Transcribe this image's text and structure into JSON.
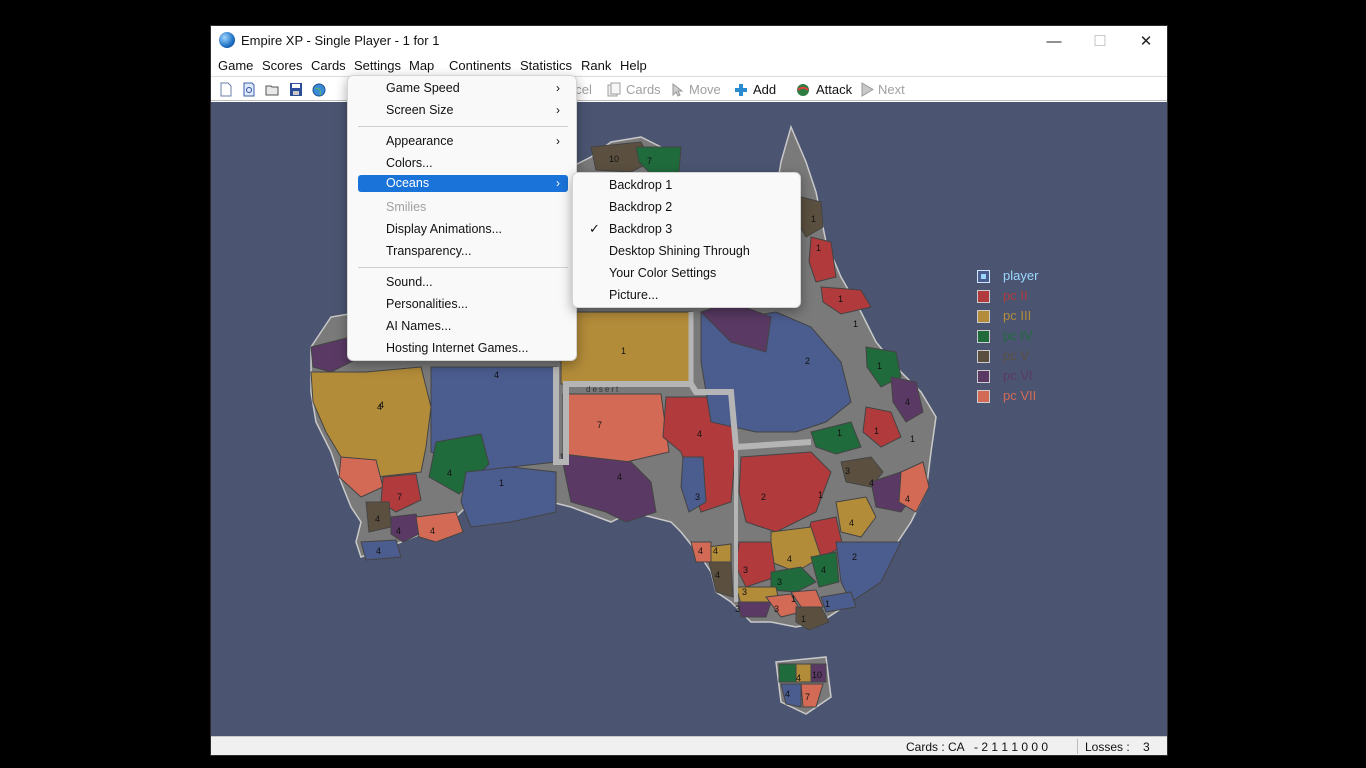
{
  "window": {
    "title": "Empire XP - Single Player - 1 for 1"
  },
  "menubar": [
    "Game",
    "Scores",
    "Cards",
    "Settings",
    "Map",
    "Continents",
    "Statistics",
    "Rank",
    "Help"
  ],
  "toolbar": {
    "cancel_label": "ncel",
    "cards_label": "Cards",
    "move_label": "Move",
    "add_label": "Add",
    "attack_label": "Attack",
    "next_label": "Next"
  },
  "settings_menu": {
    "game_speed": "Game Speed",
    "screen_size": "Screen Size",
    "appearance": "Appearance",
    "colors": "Colors...",
    "oceans": "Oceans",
    "smilies": "Smilies",
    "display_animations": "Display Animations...",
    "transparency": "Transparency...",
    "sound": "Sound...",
    "personalities": "Personalities...",
    "ai_names": "AI Names...",
    "hosting": "Hosting Internet Games..."
  },
  "oceans_menu": {
    "backdrop1": "Backdrop 1",
    "backdrop2": "Backdrop 2",
    "backdrop3": "Backdrop 3",
    "desktop": "Desktop Shining Through",
    "your_colors": "Your Color Settings",
    "picture": "Picture...",
    "checked": "Backdrop 3"
  },
  "map": {
    "desert_label": "desert",
    "territory_numbers": [
      "10",
      "7",
      "1",
      "1",
      "1",
      "2",
      "1",
      "1",
      "1",
      "1",
      "1",
      "3",
      "4",
      "2",
      "4",
      "2",
      "4",
      "1",
      "4",
      "4",
      "4",
      "1",
      "3",
      "3",
      "3",
      "3",
      "1",
      "1",
      "1",
      "1",
      "2",
      "1",
      "4",
      "4",
      "3",
      "7",
      "4",
      "1",
      "4",
      "4",
      "4",
      "1",
      "4",
      "4",
      "7",
      "4",
      "4",
      "4",
      "4",
      "4",
      "10",
      "4",
      "7"
    ]
  },
  "legend": [
    {
      "name": "player",
      "color": "#9ad7ff"
    },
    {
      "name": "pc II",
      "color": "#b13a3c"
    },
    {
      "name": "pc III",
      "color": "#b38c3a"
    },
    {
      "name": "pc IV",
      "color": "#1f6b3c"
    },
    {
      "name": "pc V",
      "color": "#5b5040"
    },
    {
      "name": "pc VI",
      "color": "#5a3a64"
    },
    {
      "name": "pc VII",
      "color": "#d36a56"
    }
  ],
  "status": {
    "cards_label": "Cards : CA",
    "cards_value": "- 2 1 1 1 0 0 0",
    "losses_label": "Losses :",
    "losses_value": "3"
  },
  "colors": {
    "ocean": "#4b5571",
    "player": "#4b5c8e",
    "pc2": "#b13a3c",
    "pc3": "#b38c3a",
    "pc4": "#1f6b3c",
    "pc5": "#5b5040",
    "pc6": "#5a3a64",
    "pc7": "#d36a56",
    "highlight": "#1a73d9"
  }
}
